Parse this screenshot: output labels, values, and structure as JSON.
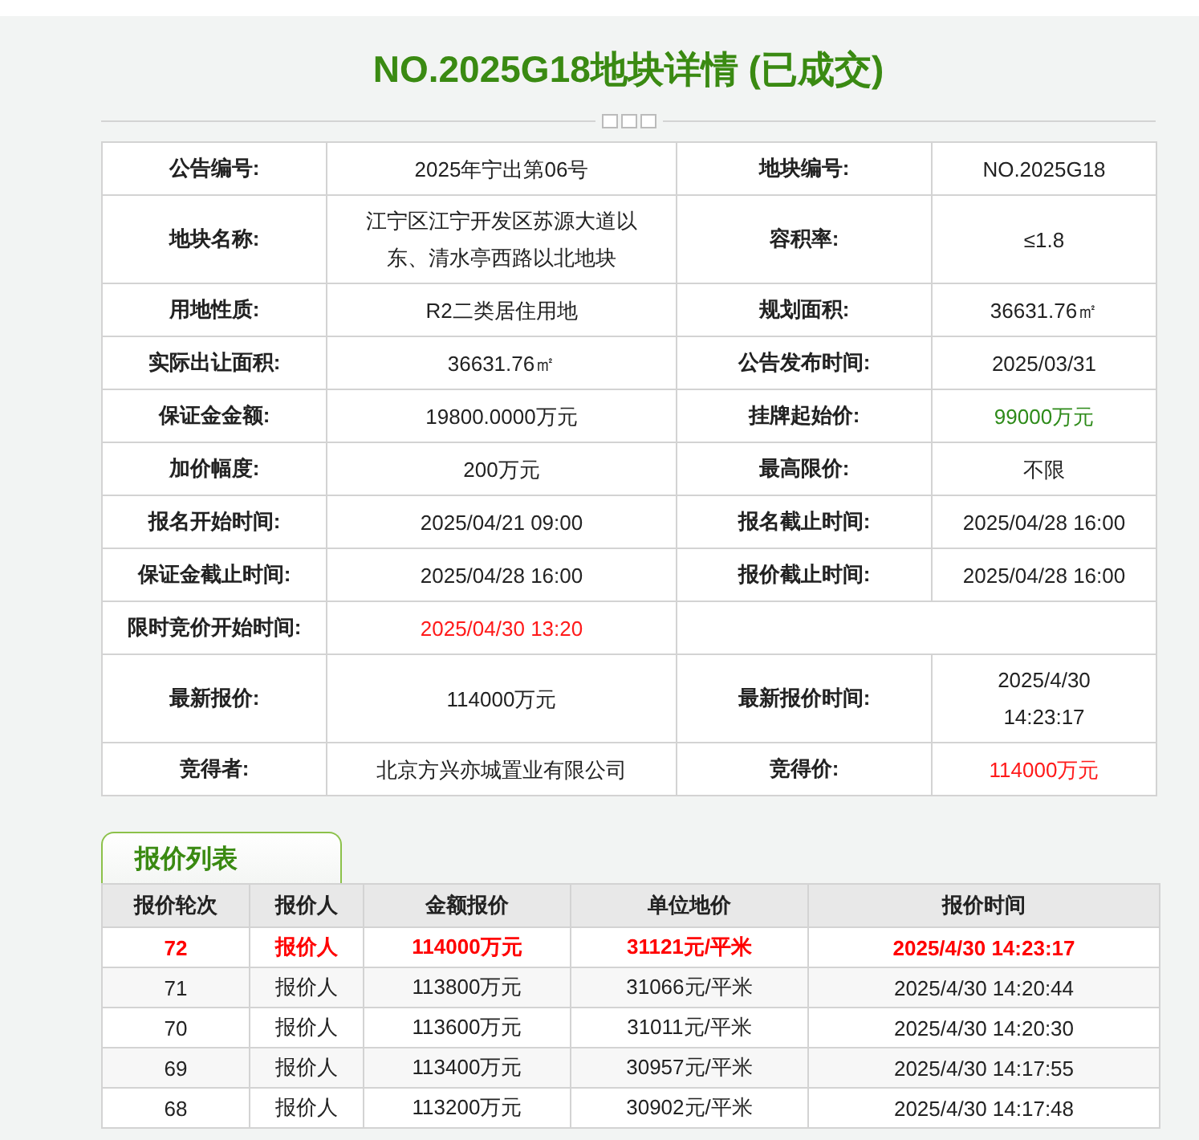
{
  "title": "NO.2025G18地块详情 (已成交)",
  "details": [
    {
      "cells": [
        {
          "label": "公告编号:",
          "value": "2025年宁出第06号",
          "color": "#222222"
        },
        {
          "label": "地块编号:",
          "value": "NO.2025G18",
          "color": "#222222"
        }
      ]
    },
    {
      "cells": [
        {
          "label": "地块名称:",
          "value": "江宁区江宁开发区苏源大道以东、清水亭西路以北地块",
          "color": "#222222"
        },
        {
          "label": "容积率:",
          "value": "≤1.8",
          "color": "#222222"
        }
      ]
    },
    {
      "cells": [
        {
          "label": "用地性质:",
          "value": "R2二类居住用地",
          "color": "#222222"
        },
        {
          "label": "规划面积:",
          "value": "36631.76㎡",
          "color": "#222222"
        }
      ]
    },
    {
      "cells": [
        {
          "label": "实际出让面积:",
          "value": "36631.76㎡",
          "color": "#222222"
        },
        {
          "label": "公告发布时间:",
          "value": "2025/03/31",
          "color": "#222222"
        }
      ]
    },
    {
      "cells": [
        {
          "label": "保证金金额:",
          "value": "19800.0000万元",
          "color": "#222222"
        },
        {
          "label": "挂牌起始价:",
          "value": "99000万元",
          "color": "#2e8b1a"
        }
      ]
    },
    {
      "cells": [
        {
          "label": "加价幅度:",
          "value": "200万元",
          "color": "#222222"
        },
        {
          "label": "最高限价:",
          "value": "不限",
          "color": "#222222"
        }
      ]
    },
    {
      "cells": [
        {
          "label": "报名开始时间:",
          "value": "2025/04/21 09:00",
          "color": "#222222"
        },
        {
          "label": "报名截止时间:",
          "value": "2025/04/28 16:00",
          "color": "#222222"
        }
      ]
    },
    {
      "cells": [
        {
          "label": "保证金截止时间:",
          "value": "2025/04/28 16:00",
          "color": "#222222"
        },
        {
          "label": "报价截止时间:",
          "value": "2025/04/28 16:00",
          "color": "#222222"
        }
      ]
    },
    {
      "cells": [
        {
          "label": "限时竞价开始时间:",
          "value": "2025/04/30 13:20",
          "color": "#ff1a1a"
        }
      ]
    },
    {
      "cells": [
        {
          "label": "最新报价:",
          "value": "114000万元",
          "color": "#222222"
        },
        {
          "label": "最新报价时间:",
          "value": "2025/4/30 14:23:17",
          "color": "#222222"
        }
      ]
    },
    {
      "cells": [
        {
          "label": "竞得者:",
          "value": "北京方兴亦城置业有限公司",
          "color": "#222222"
        },
        {
          "label": "竞得价:",
          "value": "114000万元",
          "color": "#ff1a1a"
        }
      ]
    }
  ],
  "bids": {
    "tab": "报价列表",
    "columns": [
      "报价轮次",
      "报价人",
      "金额报价",
      "单位地价",
      "报价时间"
    ],
    "rows": [
      {
        "highlighted": true,
        "cells": [
          "72",
          "报价人",
          "114000万元",
          "31121元/平米",
          "2025/4/30 14:23:17"
        ]
      },
      {
        "highlighted": false,
        "cells": [
          "71",
          "报价人",
          "113800万元",
          "31066元/平米",
          "2025/4/30 14:20:44"
        ]
      },
      {
        "highlighted": false,
        "cells": [
          "70",
          "报价人",
          "113600万元",
          "31011元/平米",
          "2025/4/30 14:20:30"
        ]
      },
      {
        "highlighted": false,
        "cells": [
          "69",
          "报价人",
          "113400万元",
          "30957元/平米",
          "2025/4/30 14:17:55"
        ]
      },
      {
        "highlighted": false,
        "cells": [
          "68",
          "报价人",
          "113200万元",
          "30902元/平米",
          "2025/4/30 14:17:48"
        ]
      }
    ]
  }
}
